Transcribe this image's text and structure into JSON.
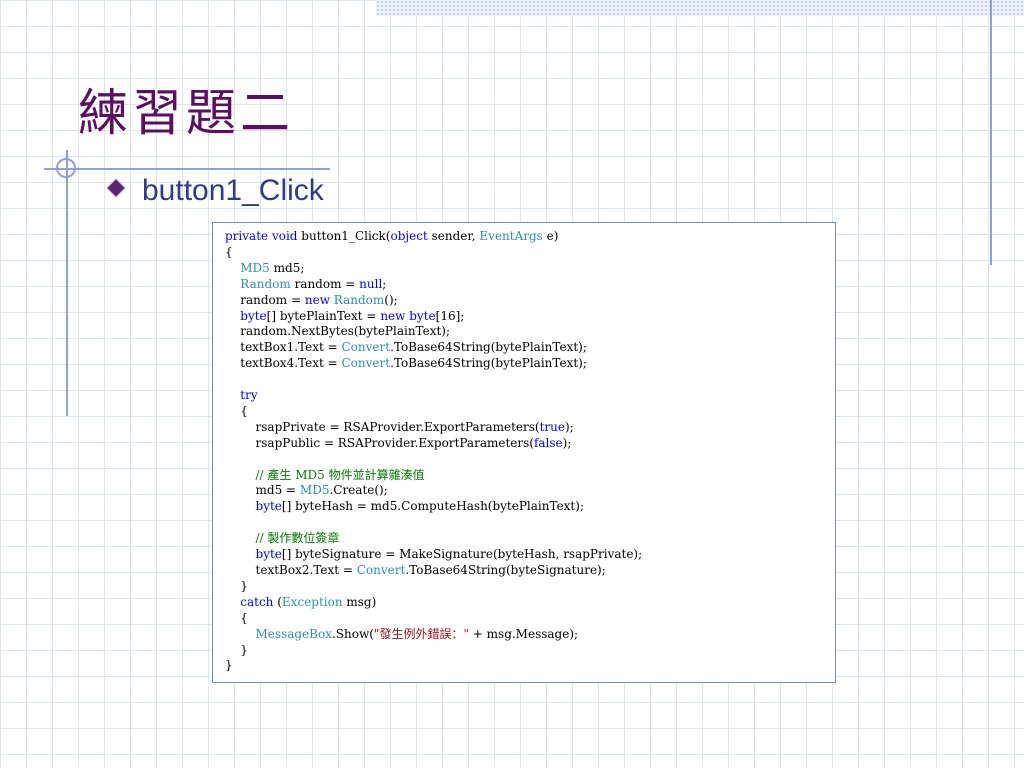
{
  "slide": {
    "title": "練習題二",
    "bullet": "button1_Click"
  },
  "code": {
    "lines": [
      [
        {
          "t": "private",
          "c": "kw"
        },
        {
          "t": " "
        },
        {
          "t": "void",
          "c": "kw"
        },
        {
          "t": " button1_Click("
        },
        {
          "t": "object",
          "c": "kw"
        },
        {
          "t": " sender, "
        },
        {
          "t": "EventArgs",
          "c": "ty"
        },
        {
          "t": " e)"
        }
      ],
      [
        {
          "t": "{"
        }
      ],
      [
        {
          "t": "    "
        },
        {
          "t": "MD5",
          "c": "ty"
        },
        {
          "t": " md5;"
        }
      ],
      [
        {
          "t": "    "
        },
        {
          "t": "Random",
          "c": "ty"
        },
        {
          "t": " random = "
        },
        {
          "t": "null",
          "c": "kw"
        },
        {
          "t": ";"
        }
      ],
      [
        {
          "t": "    random = "
        },
        {
          "t": "new",
          "c": "kw"
        },
        {
          "t": " "
        },
        {
          "t": "Random",
          "c": "ty"
        },
        {
          "t": "();"
        }
      ],
      [
        {
          "t": "    "
        },
        {
          "t": "byte",
          "c": "kw"
        },
        {
          "t": "[] bytePlainText = "
        },
        {
          "t": "new",
          "c": "kw"
        },
        {
          "t": " "
        },
        {
          "t": "byte",
          "c": "kw"
        },
        {
          "t": "[16];"
        }
      ],
      [
        {
          "t": "    random.NextBytes(bytePlainText);"
        }
      ],
      [
        {
          "t": "    textBox1.Text = "
        },
        {
          "t": "Convert",
          "c": "ty"
        },
        {
          "t": ".ToBase64String(bytePlainText);"
        }
      ],
      [
        {
          "t": "    textBox4.Text = "
        },
        {
          "t": "Convert",
          "c": "ty"
        },
        {
          "t": ".ToBase64String(bytePlainText);"
        }
      ],
      [
        {
          "t": ""
        }
      ],
      [
        {
          "t": "    "
        },
        {
          "t": "try",
          "c": "kw"
        }
      ],
      [
        {
          "t": "    {"
        }
      ],
      [
        {
          "t": "        rsapPrivate = RSAProvider.ExportParameters("
        },
        {
          "t": "true",
          "c": "kw"
        },
        {
          "t": ");"
        }
      ],
      [
        {
          "t": "        rsapPublic = RSAProvider.ExportParameters("
        },
        {
          "t": "false",
          "c": "kw"
        },
        {
          "t": ");"
        }
      ],
      [
        {
          "t": ""
        }
      ],
      [
        {
          "t": "        "
        },
        {
          "t": "// 產生 MD5 物件並計算雜湊值",
          "c": "cm"
        }
      ],
      [
        {
          "t": "        md5 = "
        },
        {
          "t": "MD5",
          "c": "ty"
        },
        {
          "t": ".Create();"
        }
      ],
      [
        {
          "t": "        "
        },
        {
          "t": "byte",
          "c": "kw"
        },
        {
          "t": "[] byteHash = md5.ComputeHash(bytePlainText);"
        }
      ],
      [
        {
          "t": ""
        }
      ],
      [
        {
          "t": "        "
        },
        {
          "t": "// 製作數位簽章",
          "c": "cm"
        }
      ],
      [
        {
          "t": "        "
        },
        {
          "t": "byte",
          "c": "kw"
        },
        {
          "t": "[] byteSignature = MakeSignature(byteHash, rsapPrivate);"
        }
      ],
      [
        {
          "t": "        textBox2.Text = "
        },
        {
          "t": "Convert",
          "c": "ty"
        },
        {
          "t": ".ToBase64String(byteSignature);"
        }
      ],
      [
        {
          "t": "    }"
        }
      ],
      [
        {
          "t": "    "
        },
        {
          "t": "catch",
          "c": "kw"
        },
        {
          "t": " ("
        },
        {
          "t": "Exception",
          "c": "ty"
        },
        {
          "t": " msg)"
        }
      ],
      [
        {
          "t": "    {"
        }
      ],
      [
        {
          "t": "        "
        },
        {
          "t": "MessageBox",
          "c": "ty"
        },
        {
          "t": ".Show("
        },
        {
          "t": "\"發生例外錯誤：\"",
          "c": "str"
        },
        {
          "t": " + msg.Message);"
        }
      ],
      [
        {
          "t": "    }"
        }
      ],
      [
        {
          "t": "}"
        }
      ]
    ]
  }
}
